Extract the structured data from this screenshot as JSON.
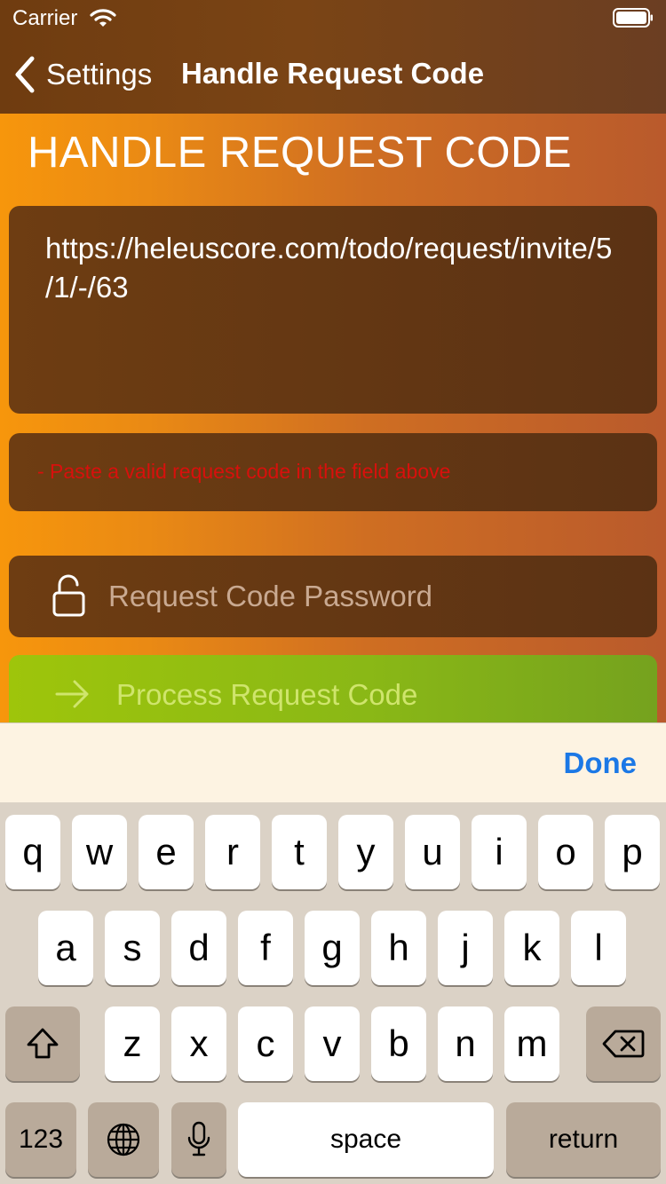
{
  "status_bar": {
    "carrier": "Carrier"
  },
  "nav": {
    "back_label": "Settings",
    "title": "Handle Request Code"
  },
  "page": {
    "heading": "HANDLE REQUEST CODE",
    "request_code": "https://heleuscore.com/todo/request/invite/5/1/-/63",
    "error_message": "- Paste a valid request code in the field above",
    "password_placeholder": "Request Code Password",
    "process_button_label": "Process Request Code"
  },
  "accessory": {
    "done_label": "Done"
  },
  "keyboard": {
    "row1": [
      "q",
      "w",
      "e",
      "r",
      "t",
      "y",
      "u",
      "i",
      "o",
      "p"
    ],
    "row2": [
      "a",
      "s",
      "d",
      "f",
      "g",
      "h",
      "j",
      "k",
      "l"
    ],
    "row3": [
      "z",
      "x",
      "c",
      "v",
      "b",
      "n",
      "m"
    ],
    "numbers_label": "123",
    "space_label": "space",
    "return_label": "return"
  },
  "icons": [
    "wifi-icon",
    "battery-icon",
    "back-chevron-icon",
    "lock-icon",
    "arrow-right-icon",
    "shift-icon",
    "backspace-icon",
    "globe-icon",
    "microphone-icon"
  ],
  "colors": {
    "error": "#d8100c",
    "done": "#1b78e6",
    "process_button": "#9ec50b"
  }
}
